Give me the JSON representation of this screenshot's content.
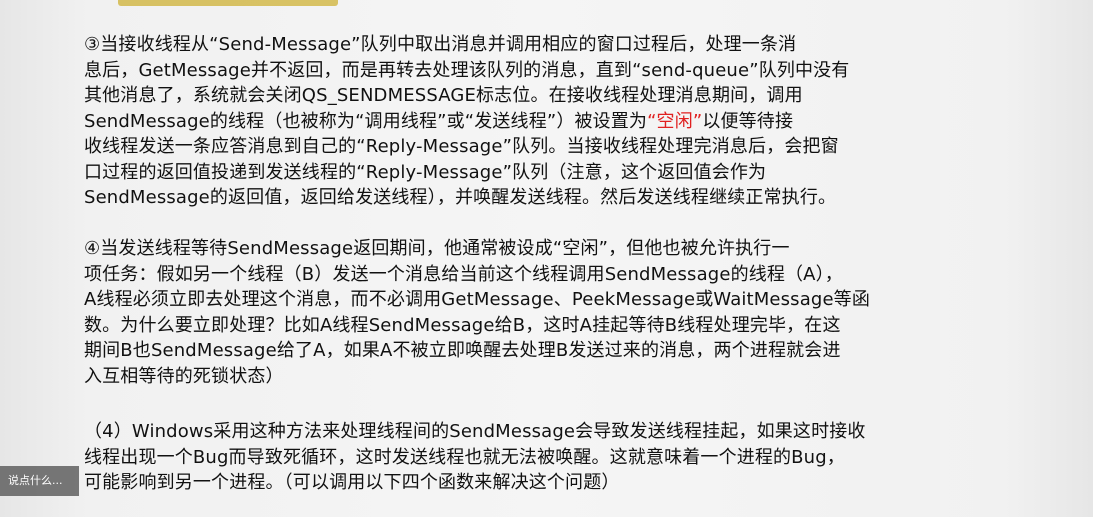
{
  "document": {
    "para3": {
      "before": "③当接收线程从“Send-Message”队列中取出消息并调用相应的窗口过程后，处理一条消\n息后，GetMessage并不返回，而是再转去处理该队列的消息，直到“send-queue”队列中没有\n其他消息了，系统就会关闭QS_SENDMESSAGE标志位。在接收线程处理消息期间，调用\nSendMessage的线程（也被称为“调用线程”或“发送线程”）被设置为",
      "highlight": "“空闲”",
      "after": "以便等待接\n收线程发送一条应答消息到自己的“Reply-Message”队列。当接收线程处理完消息后，会把窗\n口过程的返回值投递到发送线程的“Reply-Message”队列（注意，这个返回值会作为\nSendMessage的返回值，返回给发送线程），并唤醒发送线程。然后发送线程继续正常执行。"
    },
    "para4": "④当发送线程等待SendMessage返回期间，他通常被设成“空闲”，但他也被允许执行一\n项任务：假如另一个线程（B）发送一个消息给当前这个线程调用SendMessage的线程（A），\nA线程必须立即去处理这个消息，而不必调用GetMessage、PeekMessage或WaitMessage等函\n数。为什么要立即处理？比如A线程SendMessage给B，这时A挂起等待B线程处理完毕，在这\n期间B也SendMessage给了A，如果A不被立即唤醒去处理B发送过来的消息，两个进程就会进\n入互相等待的死锁状态）",
    "para_windows": "（4）Windows采用这种方法来处理线程间的SendMessage会导致发送线程挂起，如果这时接收\n线程出现一个Bug而导致死循环，这时发送线程也就无法被唤醒。这就意味着一个进程的Bug，\n可能影响到另一个进程。（可以调用以下四个函数来解决这个问题）"
  },
  "overlay": {
    "danmaku_placeholder": "说点什么..."
  },
  "colors": {
    "text": "#111111",
    "highlight": "#e02020",
    "background": "#f5f5f5"
  }
}
